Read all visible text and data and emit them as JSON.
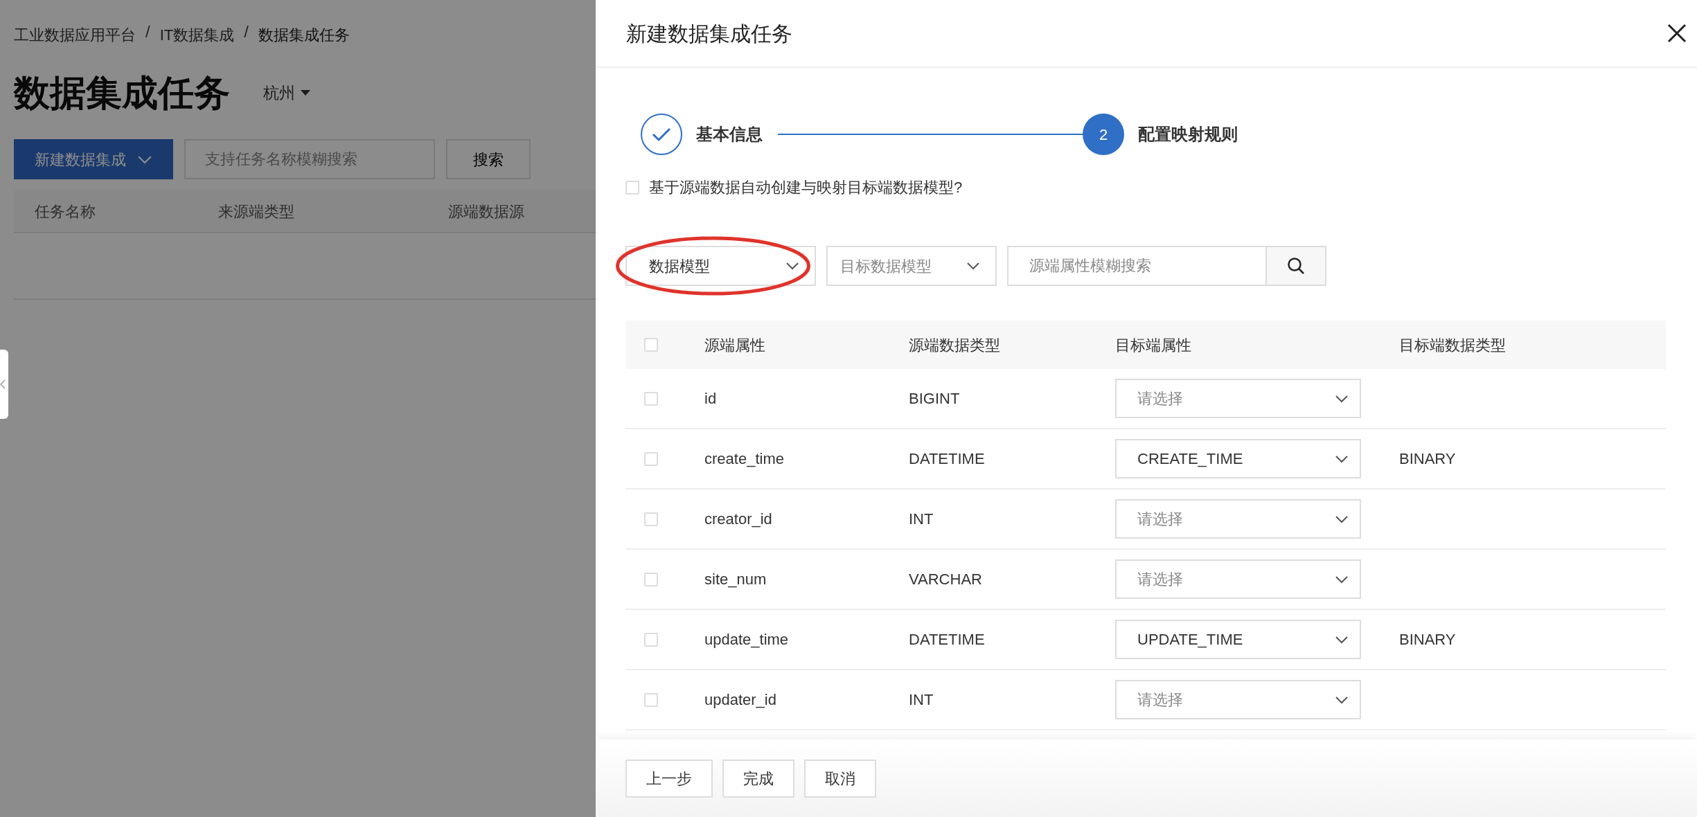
{
  "page": {
    "breadcrumb": [
      {
        "kind": "link",
        "text": "工业数据应用平台"
      },
      {
        "kind": "separator",
        "text": "/"
      },
      {
        "kind": "link",
        "text": "IT数据集成"
      },
      {
        "kind": "separator",
        "text": "/"
      },
      {
        "kind": "current",
        "text": "数据集成任务"
      }
    ],
    "title": "数据集成任务",
    "region": "杭州",
    "new_button": "新建数据集成",
    "search": {
      "placeholder": "支持任务名称模糊搜索"
    },
    "search_button": "搜索",
    "columns": [
      "任务名称",
      "来源端类型",
      "源端数据源"
    ]
  },
  "drawer": {
    "title": "新建数据集成任务",
    "steps": [
      {
        "label": "基本信息",
        "done": true
      },
      {
        "number": "2",
        "label": "配置映射规则",
        "done": false
      }
    ],
    "auto_create": {
      "label": "基于源端数据自动创建与映射目标端数据模型?",
      "checked": false
    },
    "filters": {
      "model_select": {
        "value": "数据模型",
        "highlighted": true
      },
      "target_select": {
        "placeholder": "目标数据模型"
      },
      "search": {
        "placeholder": "源端属性模糊搜索"
      }
    },
    "table": {
      "all_checked": false,
      "columns": [
        "源端属性",
        "源端数据类型",
        "目标端属性",
        "目标端数据类型"
      ],
      "rows": [
        {
          "checked": false,
          "source_attr": "id",
          "source_type": "BIGINT",
          "target_placeholder": "请选择"
        },
        {
          "checked": false,
          "source_attr": "create_time",
          "source_type": "DATETIME",
          "target": "CREATE_TIME",
          "target_type": "BINARY"
        },
        {
          "checked": false,
          "source_attr": "creator_id",
          "source_type": "INT",
          "target_placeholder": "请选择"
        },
        {
          "checked": false,
          "source_attr": "site_num",
          "source_type": "VARCHAR",
          "target_placeholder": "请选择"
        },
        {
          "checked": false,
          "source_attr": "update_time",
          "source_type": "DATETIME",
          "target": "UPDATE_TIME",
          "target_type": "BINARY"
        },
        {
          "checked": false,
          "source_attr": "updater_id",
          "source_type": "INT",
          "target_placeholder": "请选择"
        }
      ]
    },
    "footer_buttons": [
      "上一步",
      "完成",
      "取消"
    ]
  }
}
